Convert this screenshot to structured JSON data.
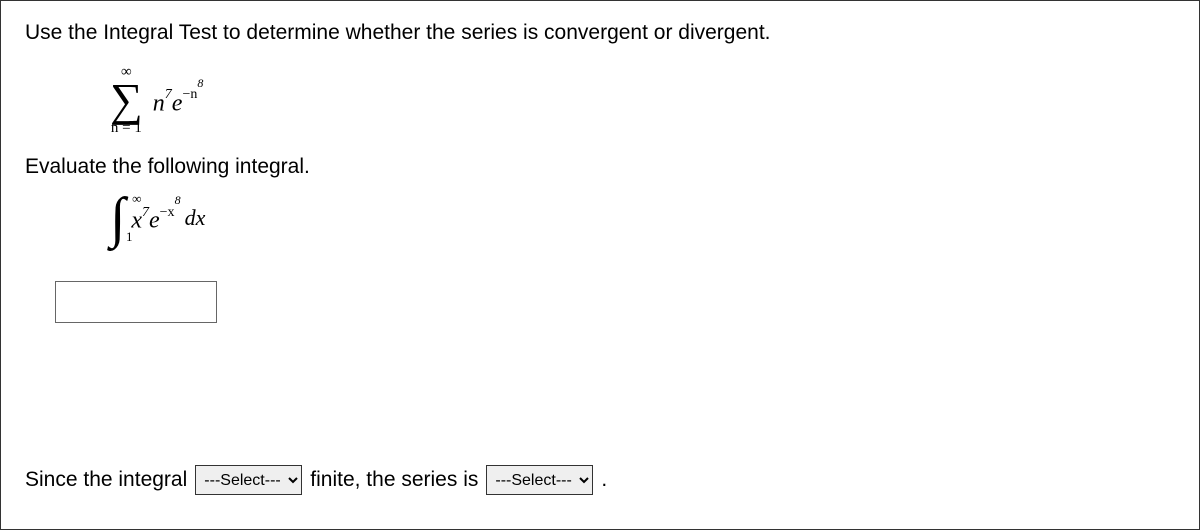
{
  "instruction": "Use the Integral Test to determine whether the series is convergent or divergent.",
  "series": {
    "upper": "∞",
    "symbol": "∑",
    "lower": "n = 1",
    "term_base1": "n",
    "term_exp1": "7",
    "term_base2": "e",
    "term_exp2_prefix": "−n",
    "term_exp2_power": "8"
  },
  "eval_text": "Evaluate the following integral.",
  "integral": {
    "upper": "∞",
    "symbol": "∫",
    "lower": "1",
    "term_base1": "x",
    "term_exp1": "7",
    "term_base2": "e",
    "term_exp2_prefix": "−x",
    "term_exp2_power": "8",
    "dx": "dx"
  },
  "answer_value": "",
  "conclusion": {
    "prefix": "Since the integral",
    "select1": "---Select---",
    "mid": "finite, the series is",
    "select2": "---Select---",
    "suffix": "."
  }
}
